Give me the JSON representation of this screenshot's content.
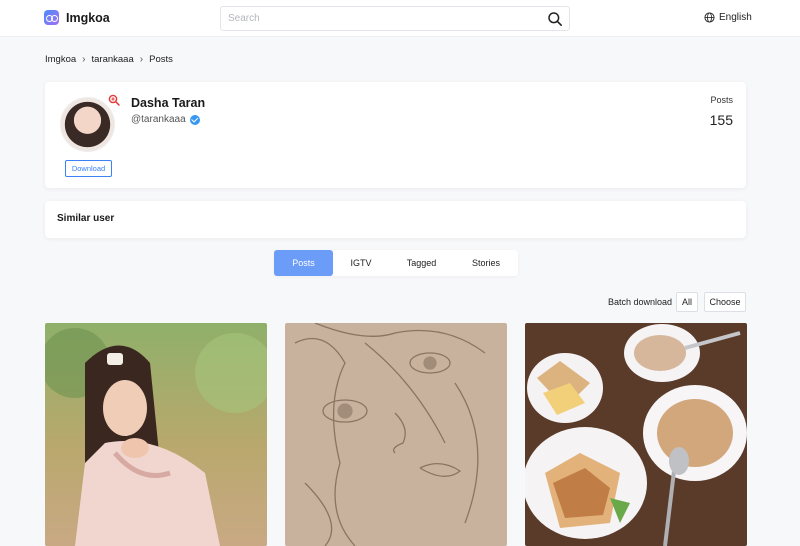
{
  "header": {
    "logo_text": "Imgkoa",
    "search_placeholder": "Search",
    "language": "English"
  },
  "breadcrumb": [
    "Imgkoa",
    "tarankaaa",
    "Posts"
  ],
  "profile": {
    "name": "Dasha Taran",
    "handle": "@tarankaaa",
    "download_label": "Download",
    "posts_label": "Posts",
    "posts_count": "155"
  },
  "similar": {
    "title": "Similar user"
  },
  "tabs": [
    {
      "label": "Posts",
      "active": true
    },
    {
      "label": "IGTV",
      "active": false
    },
    {
      "label": "Tagged",
      "active": false
    },
    {
      "label": "Stories",
      "active": false
    }
  ],
  "toolbar": {
    "batch_label": "Batch download",
    "all_label": "All",
    "choose_label": "Choose"
  },
  "colors": {
    "accent": "#3b82f6",
    "active_tab": "#6b9cf8",
    "verified": "#3897f0",
    "zoom": "#e53935"
  },
  "icons": [
    "logo-icon",
    "search-icon",
    "globe-icon",
    "zoom-icon",
    "verified-icon"
  ]
}
